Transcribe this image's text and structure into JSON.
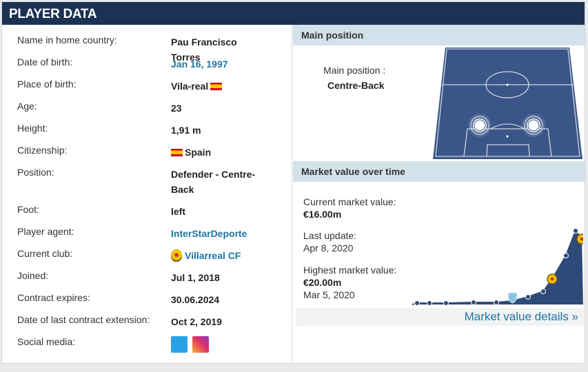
{
  "header": {
    "title": "PLAYER DATA"
  },
  "player_data": [
    {
      "label": "Name in home country:",
      "value": "Pau Francisco Torres"
    },
    {
      "label": "Date of birth:",
      "value": "Jan 16, 1997"
    },
    {
      "label": "Place of birth:",
      "value": "Vila-real"
    },
    {
      "label": "Age:",
      "value": "23"
    },
    {
      "label": "Height:",
      "value": "1,91 m"
    },
    {
      "label": "Citizenship:",
      "value": "Spain"
    },
    {
      "label": "Position:",
      "value": "Defender - Centre-Back"
    },
    {
      "label": "Foot:",
      "value": "left"
    },
    {
      "label": "Player agent:",
      "value": "InterStarDeporte"
    },
    {
      "label": "Current club:",
      "value": "Villarreal CF"
    },
    {
      "label": "Joined:",
      "value": "Jul 1, 2018"
    },
    {
      "label": "Contract expires:",
      "value": "30.06.2024"
    },
    {
      "label": "Date of last contract extension:",
      "value": "Oct 2, 2019"
    },
    {
      "label": "Social media:",
      "value": ""
    }
  ],
  "main_position": {
    "title": "Main position",
    "label": "Main position :",
    "value": "Centre-Back"
  },
  "market": {
    "title": "Market value over time",
    "current_label": "Current market value:",
    "current_value": "€16.00m",
    "update_label": "Last update:",
    "update_date": "Apr 8, 2020",
    "highest_label": "Highest market value:",
    "highest_value": "€20.00m",
    "highest_date": "Mar 5, 2020",
    "details_link": "Market value details »"
  },
  "colors": {
    "header_bg": "#1b3253",
    "section_bg": "#d3e1eb",
    "link": "#1d75a3",
    "pitch": "#3a5688",
    "chart_fill": "#2e4a78"
  }
}
